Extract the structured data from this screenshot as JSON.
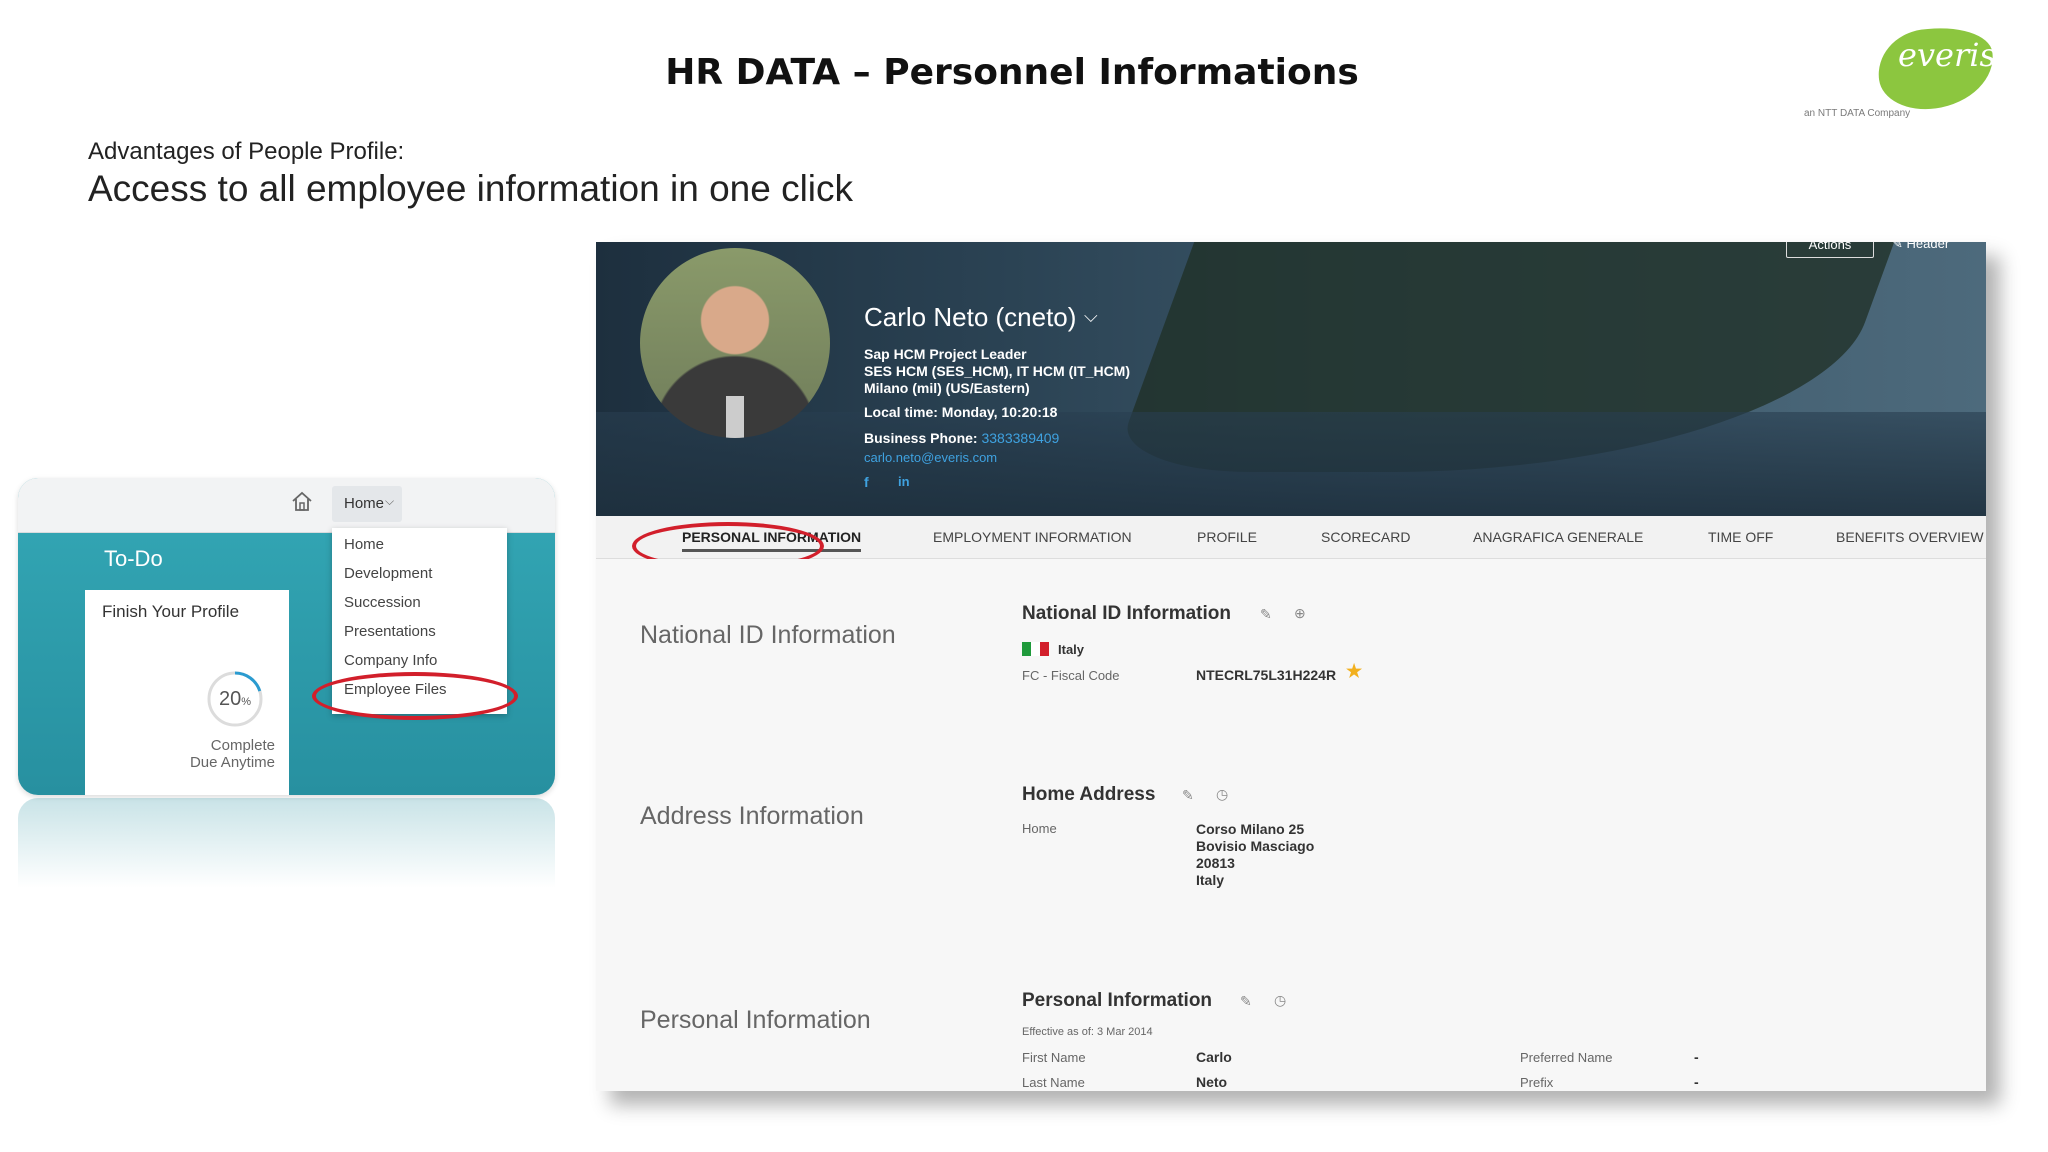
{
  "slide": {
    "title": "HR DATA – Personnel Informations",
    "subtitle_small": "Advantages of People Profile:",
    "subtitle_large": "Access to all employee information in one click"
  },
  "logo": {
    "text": "everis",
    "subtext": "an NTT DATA Company",
    "color": "#8cc63f"
  },
  "left_panel": {
    "home_menu_label": "Home",
    "todo_title": "To-Do",
    "todo_card_title": "Finish Your Profile",
    "progress_percent": 20,
    "progress_text": "20",
    "progress_unit": "%",
    "complete_label": "Complete",
    "due_label": "Due Anytime",
    "menu_items": [
      "Home",
      "Development",
      "Succession",
      "Presentations",
      "Company Info",
      "Employee Files"
    ],
    "highlight_color": "#d21f2b"
  },
  "profile": {
    "actions_label": "Actions",
    "header_label": "Header",
    "name": "Carlo Neto (cneto)",
    "job_title": "Sap HCM Project Leader",
    "department": "SES HCM (SES_HCM), IT HCM (IT_HCM)",
    "location": "Milano (mil) (US/Eastern)",
    "local_time": "Local time: Monday, 10:20:18",
    "phone_label": "Business Phone:",
    "phone_value": "3383389409",
    "email": "carlo.neto@everis.com",
    "social_facebook": "f",
    "social_linkedin": "in"
  },
  "tabs": [
    "PERSONAL INFORMATION",
    "EMPLOYMENT INFORMATION",
    "PROFILE",
    "SCORECARD",
    "ANAGRAFICA GENERALE",
    "TIME OFF",
    "BENEFITS OVERVIEW"
  ],
  "national_id": {
    "section_label": "National ID Information",
    "block_title": "National ID Information",
    "country": "Italy",
    "fc_label": "FC - Fiscal Code",
    "fc_value": "NTECRL75L31H224R",
    "star": "★"
  },
  "address": {
    "section_label": "Address Information",
    "block_title": "Home Address",
    "type_label": "Home",
    "line1": "Corso Milano 25",
    "line2": "Bovisio Masciago",
    "line3": "20813",
    "line4": "Italy"
  },
  "personal": {
    "section_label": "Personal Information",
    "block_title": "Personal Information",
    "effective": "Effective as of: 3 Mar 2014",
    "first_name_label": "First Name",
    "first_name": "Carlo",
    "last_name_label": "Last Name",
    "last_name": "Neto",
    "preferred_name_label": "Preferred Name",
    "preferred_name": "-",
    "prefix_label": "Prefix",
    "prefix": "-"
  },
  "icons": {
    "edit": "✎",
    "history": "◷",
    "add": "⊕",
    "chevron": "⌵"
  }
}
